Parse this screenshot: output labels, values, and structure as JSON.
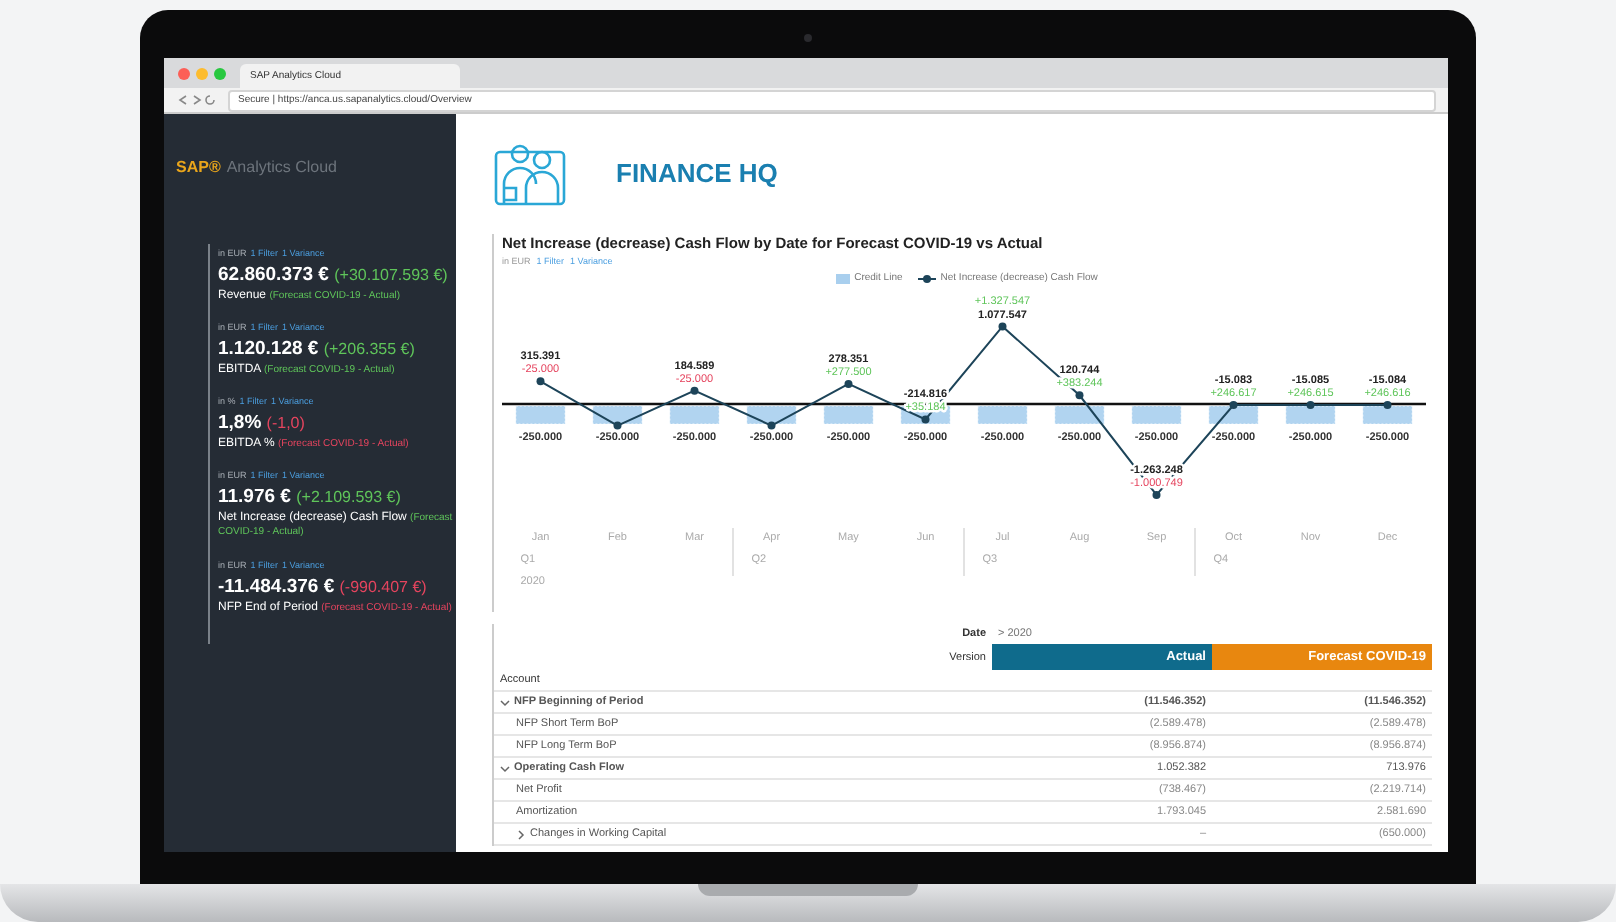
{
  "browser": {
    "tab_title": "SAP Analytics Cloud",
    "address": "Secure | https://anca.us.sapanalytics.cloud/Overview"
  },
  "sidebar": {
    "logo_brand": "SAP®",
    "logo_product": "Analytics Cloud",
    "tiles": [
      {
        "meta": "in EUR",
        "filter": "1 Filter",
        "variance_link": "1 Variance",
        "value": "62.860.373 €",
        "variance": "(+30.107.593 €)",
        "label": "Revenue",
        "note": "(Forecast COVID-19 - Actual)",
        "kind": "increase"
      },
      {
        "meta": "in EUR",
        "filter": "1 Filter",
        "variance_link": "1 Variance",
        "value": "1.120.128 €",
        "variance": "(+206.355 €)",
        "label": "EBITDA",
        "note": "(Forecast COVID-19 - Actual)",
        "kind": "increase"
      },
      {
        "meta": "in %",
        "filter": "1 Filter",
        "variance_link": "1 Variance",
        "value": "1,8%",
        "variance": "(-1,0)",
        "label": "EBITDA %",
        "note": "(Forecast COVID-19 - Actual)",
        "kind": "decrease"
      },
      {
        "meta": "in EUR",
        "filter": "1 Filter",
        "variance_link": "1 Variance",
        "value": "11.976 €",
        "variance": "(+2.109.593 €)",
        "label": "Net Increase (decrease) Cash Flow",
        "note": "(Forecast COVID-19 - Actual)",
        "kind": "increase"
      },
      {
        "meta": "in EUR",
        "filter": "1 Filter",
        "variance_link": "1 Variance",
        "value": "-11.484.376 €",
        "variance": "(-990.407 €)",
        "label": "NFP End of Period",
        "note": "(Forecast COVID-19 - Actual)",
        "kind": "decrease"
      }
    ]
  },
  "header": {
    "title": "FINANCE HQ"
  },
  "chart": {
    "meta": "in EUR",
    "filter": "1 Filter",
    "variance_link": "1 Variance",
    "quarters": [
      "Q1",
      "Q2",
      "Q3",
      "Q4"
    ],
    "year": "2020",
    "variance_labels": [
      {
        "text": "-25.000",
        "kind": "decrease"
      },
      {
        "text": "-25.000",
        "kind": "decrease"
      },
      {
        "text": "+277.500",
        "kind": "increase"
      },
      {
        "text": "+35.184",
        "kind": "increase"
      },
      {
        "text": "+1.327.547",
        "kind": "increase"
      },
      {
        "text": "+383.244",
        "kind": "increase"
      },
      {
        "text": "-1.000.749",
        "kind": "decrease"
      },
      {
        "text": "+246.617",
        "kind": "increase"
      },
      {
        "text": "+246.615",
        "kind": "increase"
      },
      {
        "text": "+246.616",
        "kind": "increase"
      }
    ],
    "chart_data": {
      "type": "bar",
      "title": "Net Increase (decrease) Cash Flow by Date for Forecast COVID-19 vs Actual",
      "categories": [
        "Jan",
        "Feb",
        "Mar",
        "Apr",
        "May",
        "Jun",
        "Jul",
        "Aug",
        "Sep",
        "Oct",
        "Nov",
        "Dec"
      ],
      "data_labels": true,
      "series": [
        {
          "name": "Credit Line",
          "color": "#a9cfee",
          "values": [
            -250000,
            -250000,
            -250000,
            -250000,
            -250000,
            -250000,
            -250000,
            -250000,
            -250000,
            -250000,
            -250000,
            -250000
          ],
          "value_labels": [
            "-250.000",
            "-250.000",
            "-250.000",
            "-250.000",
            "-250.000",
            "-250.000",
            "-250.000",
            "-250.000",
            "-250.000",
            "-250.000",
            "-250.000",
            "-250.000"
          ]
        },
        {
          "name": "Net Increase (decrease) Cash Flow",
          "type": "line",
          "marker": "circle",
          "color": "#1d4459",
          "values": [
            315391,
            -300000,
            184589,
            -300000,
            278351,
            -214816,
            1077547,
            120744,
            -1263248,
            -15083,
            -15085,
            -15084
          ],
          "value_labels": [
            "315.391",
            null,
            "184.589",
            null,
            "278.351",
            "-214.816",
            "1.077.547",
            "120.744",
            "-1.263.248",
            "-15.083",
            "-15.085",
            "-15.084"
          ]
        }
      ]
    }
  },
  "table": {
    "date_label": "Date",
    "date_value": "> 2020",
    "version_label": "Version",
    "row_header": "Account",
    "columns": [
      {
        "label": "Actual",
        "color": "#0f6b8c"
      },
      {
        "label": "Forecast COVID-19",
        "color": "#e8870f"
      }
    ],
    "rows": [
      {
        "label": "NFP Beginning of Period",
        "values": [
          "(11.546.352)",
          "(11.546.352)"
        ],
        "expanded": true,
        "children": [
          {
            "label": "NFP Short Term BoP",
            "values": [
              "(2.589.478)",
              "(2.589.478)"
            ]
          },
          {
            "label": "NFP Long Term BoP",
            "values": [
              "(8.956.874)",
              "(8.956.874)"
            ]
          }
        ]
      },
      {
        "label": "Operating Cash Flow",
        "values": [
          "1.052.382",
          "713.976"
        ],
        "expanded": true,
        "children": [
          {
            "label": "Net Profit",
            "values": [
              "(738.467)",
              "(2.219.714)"
            ]
          },
          {
            "label": "Amortization",
            "values": [
              "1.793.045",
              "2.581.690"
            ]
          },
          {
            "label": "Changes in Working Capital",
            "values": [
              "–",
              "(650.000)"
            ],
            "expanded": false
          }
        ]
      }
    ]
  }
}
